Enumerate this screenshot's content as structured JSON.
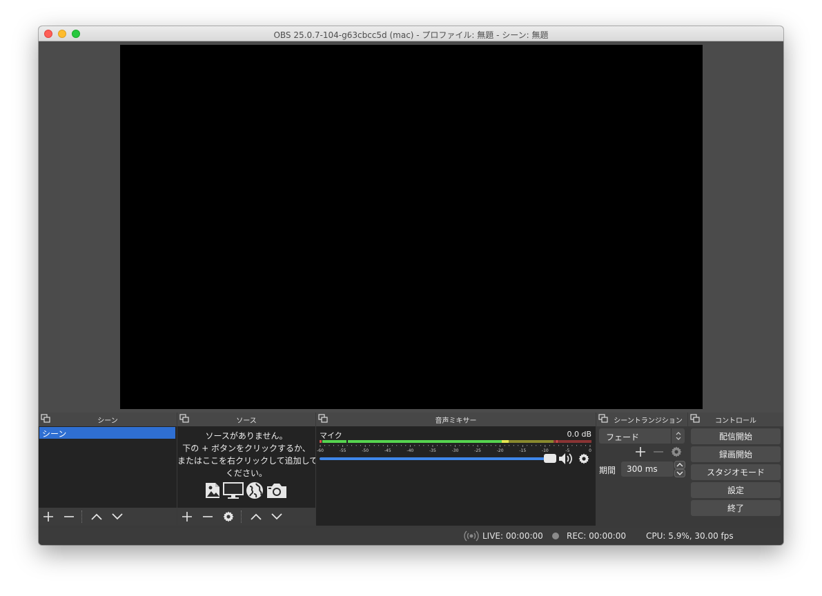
{
  "window": {
    "title": "OBS 25.0.7-104-g63cbcc5d (mac) - プロファイル: 無題 - シーン: 無題"
  },
  "scenes": {
    "title": "シーン",
    "items": [
      "シーン"
    ]
  },
  "sources": {
    "title": "ソース",
    "empty_lines": [
      "ソースがありません。",
      "下の + ボタンをクリックするか、",
      "またはここを右クリックして追加して",
      "ください。"
    ]
  },
  "mixer": {
    "title": "音声ミキサー",
    "channel_name": "マイク",
    "level": "0.0 dB",
    "fader_fraction": 1.0,
    "ticks": [
      "-60",
      "-55",
      "-50",
      "-45",
      "-40",
      "-35",
      "-30",
      "-25",
      "-20",
      "-15",
      "-10",
      "-5",
      "0"
    ]
  },
  "transitions": {
    "title": "シーントランジション",
    "selected": "フェード",
    "duration_label": "期間",
    "duration_value": "300 ms"
  },
  "controls": {
    "title": "コントロール",
    "start_streaming": "配信開始",
    "start_recording": "録画開始",
    "studio_mode": "スタジオモード",
    "settings": "設定",
    "exit": "終了"
  },
  "status": {
    "live": "LIVE: 00:00:00",
    "rec": "REC: 00:00:00",
    "cpu": "CPU: 5.9%, 30.00 fps"
  },
  "colors": {
    "selection": "#2f6fd2",
    "meter_green": "#56d44f",
    "meter_yellow": "#e6e650",
    "meter_red": "#d84c4c",
    "fader": "#3f87ea"
  }
}
